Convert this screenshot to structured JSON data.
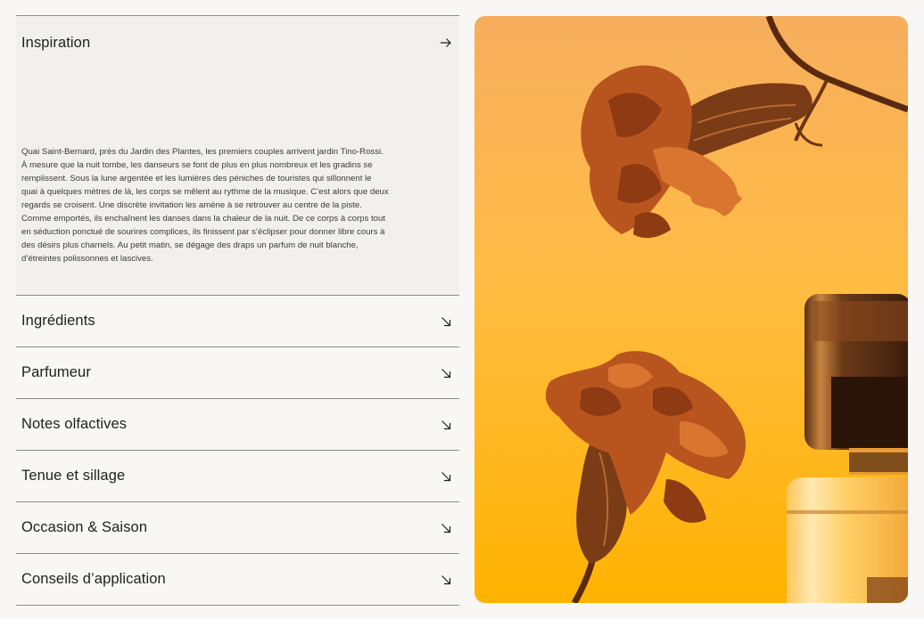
{
  "accordion": {
    "items": [
      {
        "label": "Inspiration",
        "icon": "arrow-right-icon",
        "state": "open",
        "body": "Quai Saint-Bernard, près du Jardin des Plantes, les premiers couples arrivent jardin Tino-Rossi. À mesure que la nuit tombe, les danseurs se font de plus en plus nombreux et les gradins se remplissent. Sous la lune argentée et les lumières des péniches de touristes qui sillonnent le quai à quelques mètres de là, les corps se mêlent au rythme de la musique. C’est alors que deux regards se croisent. Une discrète invitation les amène à se retrouver au centre de la piste. Comme emportés, ils enchaînent les danses dans la chaleur de la nuit. De ce corps à corps tout en séduction ponctué de sourires complices, ils finissent par s’éclipser pour donner libre cours à des désirs plus charnels. Au petit matin, se dégage des draps un parfum de nuit blanche, d’étreintes polissonnes et lascives."
      },
      {
        "label": "Ingrédients",
        "icon": "arrow-down-right-icon",
        "state": "closed"
      },
      {
        "label": "Parfumeur",
        "icon": "arrow-down-right-icon",
        "state": "closed"
      },
      {
        "label": "Notes olfactives",
        "icon": "arrow-down-right-icon",
        "state": "closed"
      },
      {
        "label": "Tenue et sillage",
        "icon": "arrow-down-right-icon",
        "state": "closed"
      },
      {
        "label": "Occasion & Saison",
        "icon": "arrow-down-right-icon",
        "state": "closed"
      },
      {
        "label": "Conseils d’application",
        "icon": "arrow-down-right-icon",
        "state": "closed"
      }
    ]
  },
  "colors": {
    "background": "#f8f7f5",
    "open_panel": "#f1f0ee",
    "divider": "#8c8c8c",
    "image_gradient_top": "#f7b25d",
    "image_gradient_bottom": "#ffb400"
  }
}
